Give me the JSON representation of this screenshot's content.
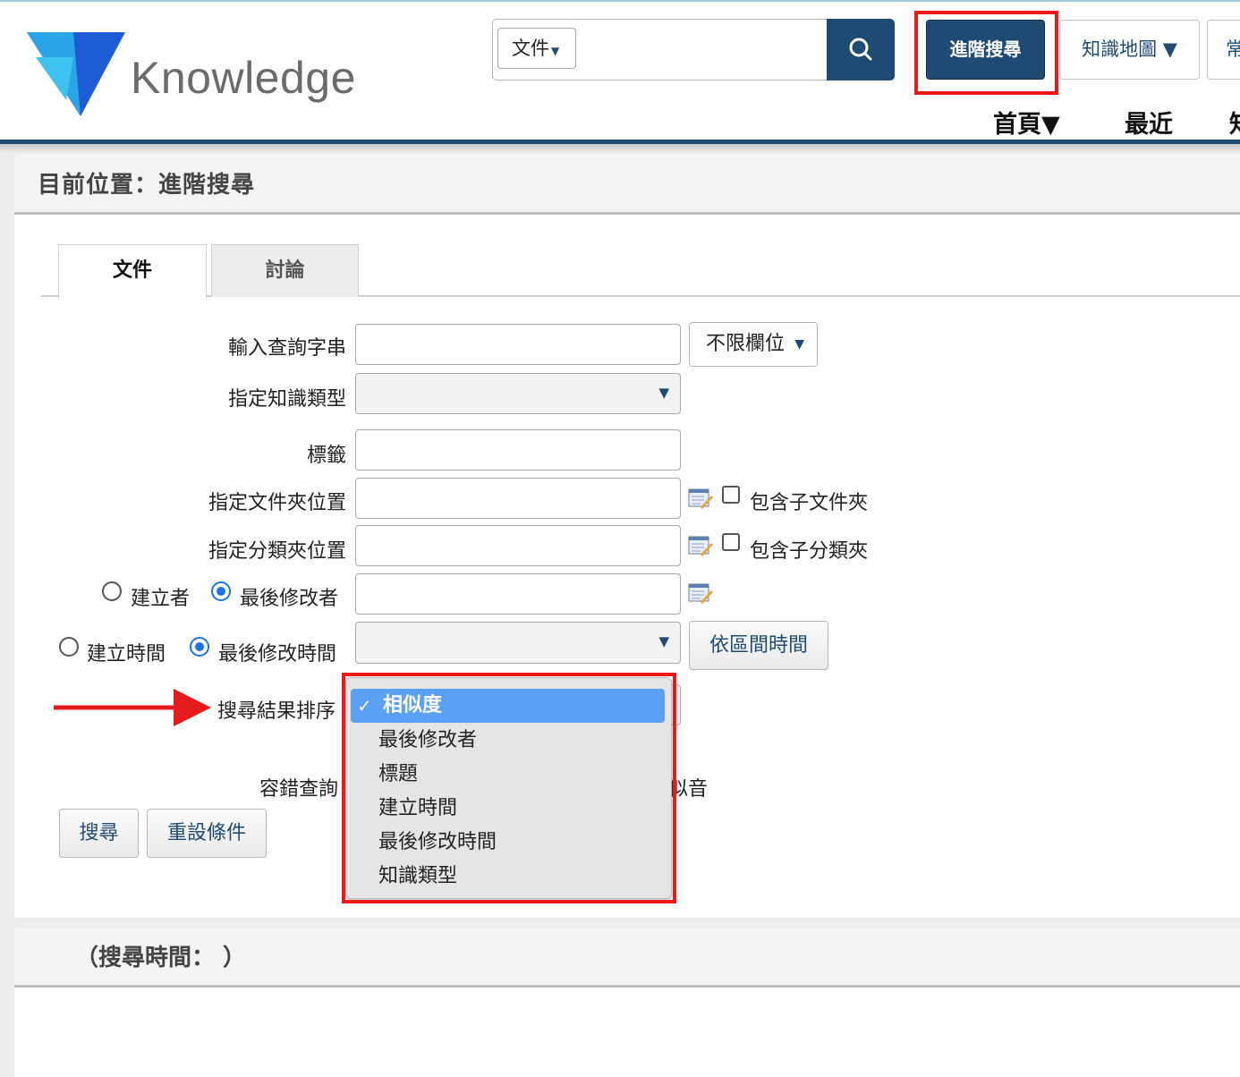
{
  "header": {
    "logo_text": "Knowledge",
    "search_scope": "文件",
    "advanced_search_label": "進階搜尋",
    "knowledge_map_label": "知識地圖 ▼",
    "common_label": "常",
    "nav": {
      "home": "首頁▼",
      "recent": "最近",
      "more": "知"
    }
  },
  "location": {
    "text": "目前位置：進階搜尋"
  },
  "tabs": [
    {
      "label": "文件",
      "active": true
    },
    {
      "label": "討論",
      "active": false
    }
  ],
  "form": {
    "query_label": "輸入查詢字串",
    "query_value": "",
    "field_scope": "不限欄位",
    "type_label": "指定知識類型",
    "type_value": "",
    "tag_label": "標籤",
    "tag_value": "",
    "folder_label": "指定文件夾位置",
    "folder_value": "",
    "include_subfolder": "包含子文件夾",
    "category_label": "指定分類夾位置",
    "category_value": "",
    "include_subcategory": "包含子分類夾",
    "creator_label": "建立者",
    "modifier_label": "最後修改者",
    "person_value": "",
    "created_time_label": "建立時間",
    "modified_time_label": "最後修改時間",
    "time_value": "",
    "range_button": "依區間時間",
    "sort_label": "搜尋結果排序",
    "fuzzy_label": "容錯查詢",
    "fuzzy_option": "近似音",
    "search_button": "搜尋",
    "reset_button": "重設條件"
  },
  "sort_dropdown": {
    "options": [
      "相似度",
      "最後修改者",
      "標題",
      "建立時間",
      "最後修改時間",
      "知識類型"
    ],
    "selected": "相似度"
  },
  "result": {
    "search_time_text": "（搜尋時間： ）"
  },
  "colors": {
    "brand_navy": "#1f4a73",
    "highlight_red": "#ef1818",
    "option_selected": "#5aa0f5"
  }
}
